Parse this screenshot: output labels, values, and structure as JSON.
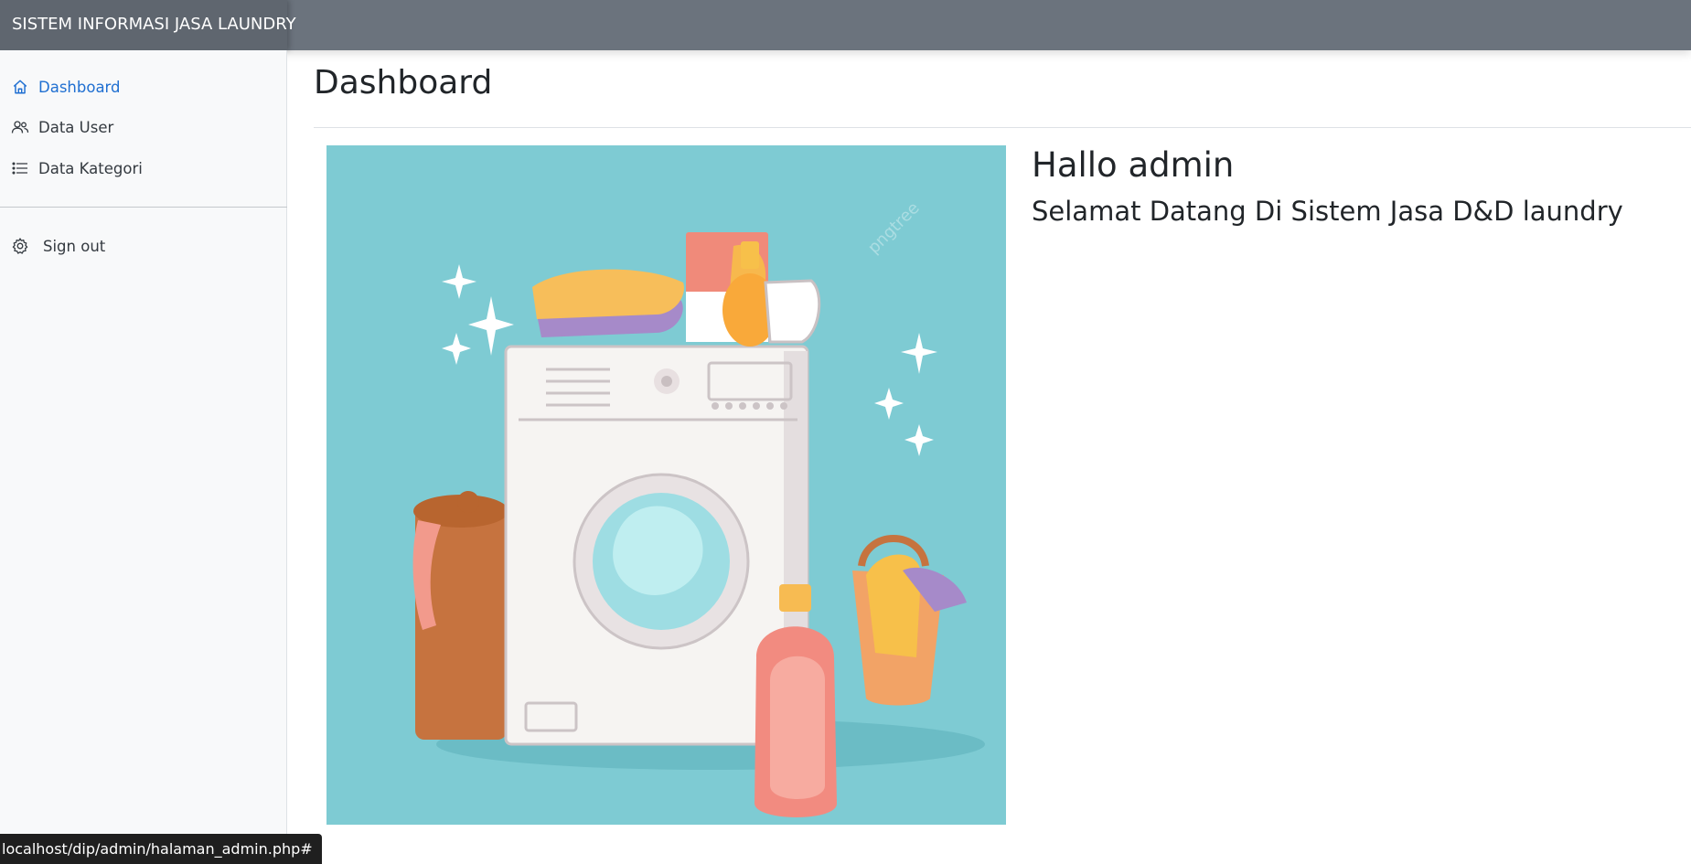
{
  "navbar": {
    "brand": "SISTEM INFORMASI JASA LAUNDRY"
  },
  "sidebar": {
    "items": [
      {
        "label": "Dashboard",
        "icon": "house-icon",
        "active": true
      },
      {
        "label": "Data User",
        "icon": "people-icon",
        "active": false
      },
      {
        "label": "Data Kategori",
        "icon": "list-icon",
        "active": false
      }
    ],
    "signout": {
      "label": "Sign out",
      "icon": "gear-icon"
    }
  },
  "main": {
    "title": "Dashboard",
    "greeting": "Hallo admin",
    "welcome": "Selamat Datang Di Sistem Jasa D&D laundry",
    "image_watermark": "pngtree"
  },
  "status_bar": {
    "url": "localhost/dip/admin/halaman_admin.php#"
  },
  "colors": {
    "navbar": "#6b737d",
    "brand_bg": "#5f666f",
    "active_link": "#1f6fd1",
    "sidebar_bg": "#f8f9fa",
    "image_bg": "#7ecbd3"
  }
}
